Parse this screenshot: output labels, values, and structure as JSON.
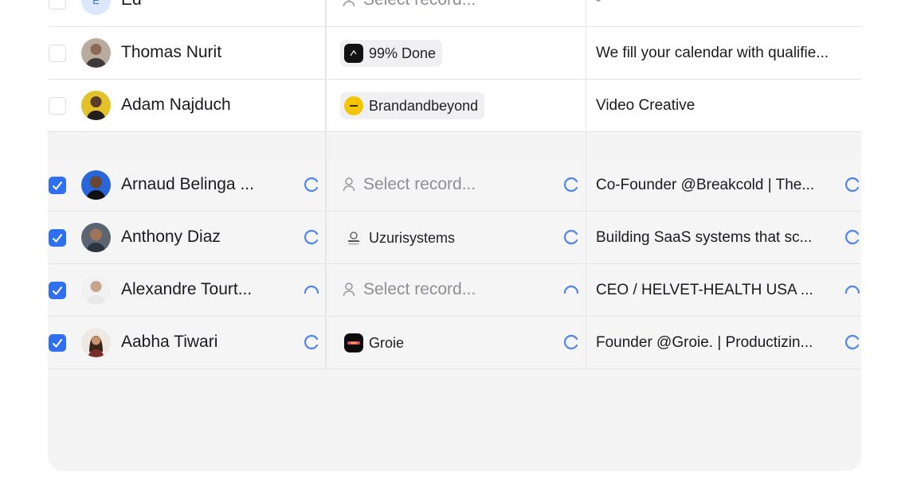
{
  "colors": {
    "accent": "#2f6ff2",
    "spinner": "#4f86e8",
    "placeholder": "#8e8e94"
  },
  "rows": [
    {
      "name": "Ed",
      "avatar_initial": "E",
      "checked": false,
      "company": "Select record...",
      "company_empty": true,
      "description": "-",
      "loading": false
    },
    {
      "name": "Thomas Nurit",
      "checked": false,
      "company": "99% Done",
      "company_logo": "dark-circle-logo",
      "description": "We fill your calendar with qualifie...",
      "loading": false
    },
    {
      "name": "Adam Najduch",
      "checked": false,
      "company": "Brandandbeyond",
      "company_logo": "yellow-circle-logo",
      "description": "Video Creative",
      "loading": false
    },
    {
      "name": "Arnaud Belinga ...",
      "checked": true,
      "company": "Select record...",
      "company_empty": true,
      "description": "Co-Founder @Breakcold | The...",
      "loading": true
    },
    {
      "name": "Anthony Diaz",
      "checked": true,
      "company": "Uzurisystems",
      "company_logo": "uzuri-logo",
      "description": "Building SaaS systems that sc...",
      "loading": true
    },
    {
      "name": "Alexandre Tourt...",
      "checked": true,
      "company": "Select record...",
      "company_empty": true,
      "description": "CEO / HELVET-HEALTH USA ...",
      "loading": true
    },
    {
      "name": "Aabha Tiwari",
      "checked": true,
      "company": "Groie",
      "company_logo": "groie-logo",
      "description": "Founder @Groie. | Productizin...",
      "loading": true
    }
  ]
}
